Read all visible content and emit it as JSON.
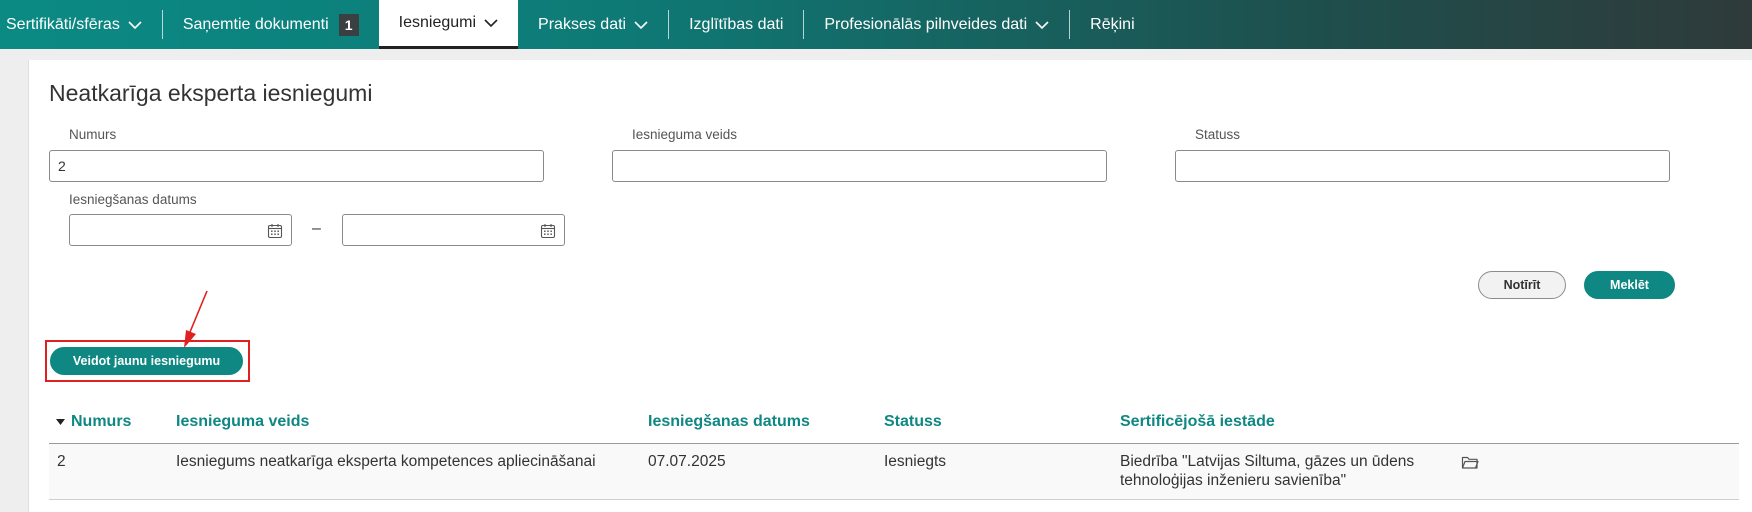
{
  "nav": {
    "items": [
      {
        "label": "Sertifikāti/sfēras",
        "dropdown": true
      },
      {
        "label": "Saņemtie dokumenti",
        "badge": "1"
      },
      {
        "label": "Iesniegumi",
        "dropdown": true,
        "active": true
      },
      {
        "label": "Prakses dati",
        "dropdown": true
      },
      {
        "label": "Izglītības dati"
      },
      {
        "label": "Profesionālās pilnveides dati",
        "dropdown": true
      },
      {
        "label": "Rēķini"
      }
    ]
  },
  "page": {
    "title": "Neatkarīga eksperta iesniegumi"
  },
  "filters": {
    "numurs_label": "Numurs",
    "numurs_value": "2",
    "veids_label": "Iesnieguma veids",
    "veids_value": "",
    "statuss_label": "Statuss",
    "statuss_value": "",
    "datums_label": "Iesniegšanas datums",
    "datums_from": "",
    "datums_to": "",
    "range_separator": "–"
  },
  "actions": {
    "clear_label": "Notīrīt",
    "search_label": "Meklēt",
    "create_label": "Veidot jaunu iesniegumu"
  },
  "table": {
    "headers": [
      "Numurs",
      "Iesnieguma veids",
      "Iesniegšanas datums",
      "Statuss",
      "Sertificējošā iestāde"
    ],
    "rows": [
      {
        "numurs": "2",
        "veids": "Iesniegums neatkarīga eksperta kompetences apliecināšanai",
        "datums": "07.07.2025",
        "statuss": "Iesniegts",
        "iestade_line1": "Biedrība \"Latvijas Siltuma, gāzes un ūdens",
        "iestade_line2": "tehnoloģijas inženieru savienība\""
      }
    ]
  },
  "colors": {
    "accent": "#0f8783",
    "highlight": "#e02020"
  },
  "icons": {
    "calendar": "calendar-icon",
    "folder": "folder-icon",
    "chevron": "chevron-down-icon",
    "sort": "sort-desc-icon",
    "annotation_arrow": "arrow-annotation"
  }
}
